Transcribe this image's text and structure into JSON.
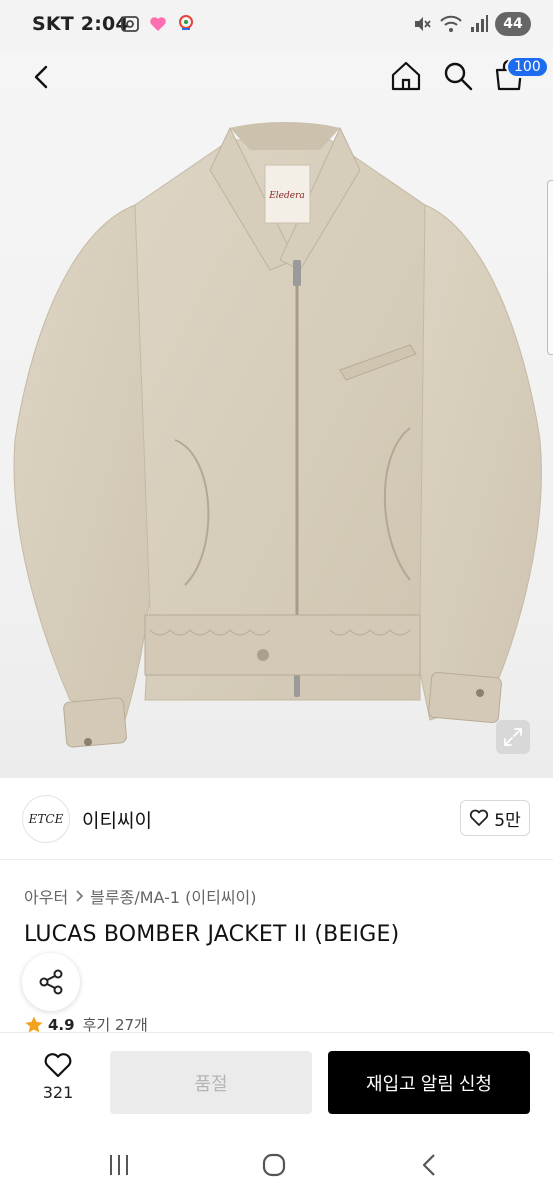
{
  "status_bar": {
    "time": "SKT 2:04",
    "battery": "44",
    "icons_left": [
      "screenshot-icon",
      "heart-icon",
      "location-icon"
    ],
    "icons_right": [
      "mute-icon",
      "wifi-icon",
      "signal-icon"
    ]
  },
  "header": {
    "icons": [
      "back-icon",
      "home-icon",
      "search-icon",
      "cart-icon"
    ],
    "cart_badge": "100"
  },
  "product_image": {
    "label_text": "Eledera",
    "expand_icon": "expand-icon"
  },
  "brand": {
    "logo_text": "ETCE",
    "name": "이티씨이",
    "likes": "5만"
  },
  "product": {
    "breadcrumb": [
      "아우터",
      "블루종/MA-1 (이티씨이)"
    ],
    "title": "LUCAS BOMBER JACKET II (BEIGE)",
    "rating": "4.9",
    "reviews": "후기 27개"
  },
  "actions": {
    "wish_count": "321",
    "soldout_label": "품절",
    "restock_label": "재입고 알림 신청"
  },
  "colors": {
    "accent_blue": "#1d6cf0",
    "star": "#f3a21c",
    "jacket_beige": "#d8cfbd"
  }
}
